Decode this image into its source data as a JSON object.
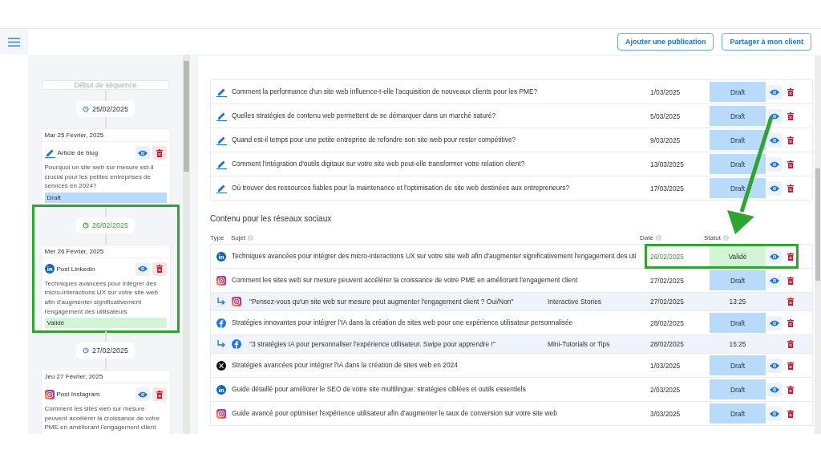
{
  "topbar": {
    "buttons": [
      "Ajouter une publication",
      "Partager à mon client"
    ]
  },
  "sequence": {
    "start_label": "Début de séquence",
    "groups": [
      {
        "date": "25/02/2025",
        "highlighted": false,
        "day": "Mar 25 Février, 2025",
        "icon": {
          "kind": "blog"
        },
        "type_label": "Article de blog",
        "text": "Pourquoi un site web sur mesure est-il crucial pour les petites entreprises de services en 2024?",
        "status": {
          "label": "Draft",
          "kind": "draft"
        }
      },
      {
        "date": "26/02/2025",
        "highlighted": true,
        "day": "Mer 26 Février, 2025",
        "icon": {
          "kind": "linkedin"
        },
        "type_label": "Post Linkedin",
        "text": "Techniques avancées pour intégrer des micro-interactions UX sur votre site web afin d'augmenter significativement l'engagement des utilisateurs",
        "status": {
          "label": "Validé",
          "kind": "validated"
        }
      },
      {
        "date": "27/02/2025",
        "highlighted": false,
        "day": "Jeu 27 Février, 2025",
        "icon": {
          "kind": "instagram"
        },
        "type_label": "Post Instagram",
        "text": "Comment les sites web sur mesure peuvent accélérer la croissance de votre PME en améliorant l'engagement client"
      }
    ]
  },
  "blog_rows": [
    {
      "subject": "Comment la performance d'un site web influence-t-elle l'acquisition de nouveaux clients pour les PME?",
      "date": "1/03/2025",
      "status": {
        "label": "Draft",
        "kind": "draft"
      }
    },
    {
      "subject": "Quelles stratégies de contenu web permettent de se démarquer dans un marché saturé?",
      "date": "5/03/2025",
      "status": {
        "label": "Draft",
        "kind": "draft"
      }
    },
    {
      "subject": "Quand est-il temps pour une petite entreprise de refondre son site web pour rester compétitive?",
      "date": "9/03/2025",
      "status": {
        "label": "Draft",
        "kind": "draft"
      }
    },
    {
      "subject": "Comment l'intégration d'outils digitaux sur votre site web peut-elle transformer votre relation client?",
      "date": "13/03/2025",
      "status": {
        "label": "Draft",
        "kind": "draft"
      }
    },
    {
      "subject": "Où trouver des ressources fiables pour la maintenance et l'optimisation de site web destinées aux entrepreneurs?",
      "date": "17/03/2025",
      "status": {
        "label": "Draft",
        "kind": "draft"
      }
    }
  ],
  "social": {
    "title": "Contenu pour les réseaux sociaux",
    "columns": [
      {
        "label": "Type",
        "help": false
      },
      {
        "label": "Sujet",
        "help": true
      },
      {
        "label": "Date",
        "help": true
      },
      {
        "label": "Statut",
        "help": true
      }
    ],
    "rows": [
      {
        "kind": "post",
        "platform": {
          "kind": "linkedin"
        },
        "highlighted": true,
        "subject": "Techniques avancées pour intégrer des micro-interactions UX sur votre site web afin d'augmenter significativement l'engagement des uti",
        "date": "26/02/2025",
        "status": {
          "label": "Validé",
          "kind": "validated"
        }
      },
      {
        "kind": "post",
        "platform": {
          "kind": "instagram"
        },
        "highlighted": false,
        "subject": "Comment les sites web sur mesure peuvent accélérer la croissance de votre PME en améliorant l'engagement client",
        "date": "27/02/2025",
        "status": {
          "label": "Draft",
          "kind": "draft"
        }
      },
      {
        "kind": "story",
        "platform": {
          "kind": "instagram"
        },
        "subject": "\"Pensez-vous qu'un site web sur mesure peut augmenter l'engagement client ? Oui/Non\"",
        "format": "Interactive Stories",
        "date": "27/02/2025",
        "time": "13:25"
      },
      {
        "kind": "post",
        "platform": {
          "kind": "facebook"
        },
        "highlighted": false,
        "subject": "Stratégies innovantes pour intégrer l'IA dans la création de sites web pour une expérience utilisateur personnalisée",
        "date": "28/02/2025",
        "status": {
          "label": "Draft",
          "kind": "draft"
        }
      },
      {
        "kind": "story",
        "platform": {
          "kind": "facebook"
        },
        "subject": "\"3 stratégies IA pour personnaliser l'expérience utilisateur. Swipe pour apprendre !\"",
        "format": "Mini-Tutorials or Tips",
        "date": "28/02/2025",
        "time": "15:25"
      },
      {
        "kind": "post",
        "platform": {
          "kind": "x"
        },
        "highlighted": false,
        "subject": "Stratégies avancées pour intégrer l'IA dans la création de sites web en 2024",
        "date": "1/03/2025",
        "status": {
          "label": "Draft",
          "kind": "draft"
        }
      },
      {
        "kind": "post",
        "platform": {
          "kind": "linkedin"
        },
        "highlighted": false,
        "subject": "Guide détaillé pour améliorer le SEO de votre site multilingue: stratégies ciblées et outils essentiels",
        "date": "2/03/2025",
        "status": {
          "label": "Draft",
          "kind": "draft"
        }
      },
      {
        "kind": "post",
        "platform": {
          "kind": "instagram"
        },
        "highlighted": false,
        "subject": "Guide avancé pour optimiser l'expérience utilisateur afin d'augmenter le taux de conversion sur votre site web",
        "date": "3/03/2025",
        "status": {
          "label": "Draft",
          "kind": "draft"
        }
      }
    ]
  }
}
